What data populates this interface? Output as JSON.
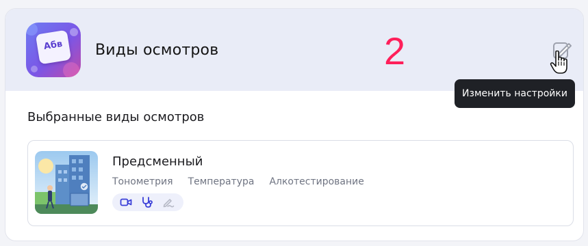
{
  "header": {
    "app_icon_text": "Абв",
    "title": "Виды осмотров",
    "step_number": "2",
    "edit_tooltip": "Изменить настройки"
  },
  "section": {
    "title": "Выбранные виды осмотров"
  },
  "exam": {
    "title": "Предсменный",
    "tags": [
      "Тонометрия",
      "Температура",
      "Алкотестирование"
    ],
    "methods": [
      "video-camera-icon",
      "stethoscope-icon",
      "signature-icon"
    ]
  },
  "colors": {
    "header_bg": "#e9ecf7",
    "accent_number": "#ff1f5a",
    "method_active": "#3a3fd8",
    "method_disabled": "#b6b9c6",
    "tooltip_bg": "#1f2126"
  }
}
